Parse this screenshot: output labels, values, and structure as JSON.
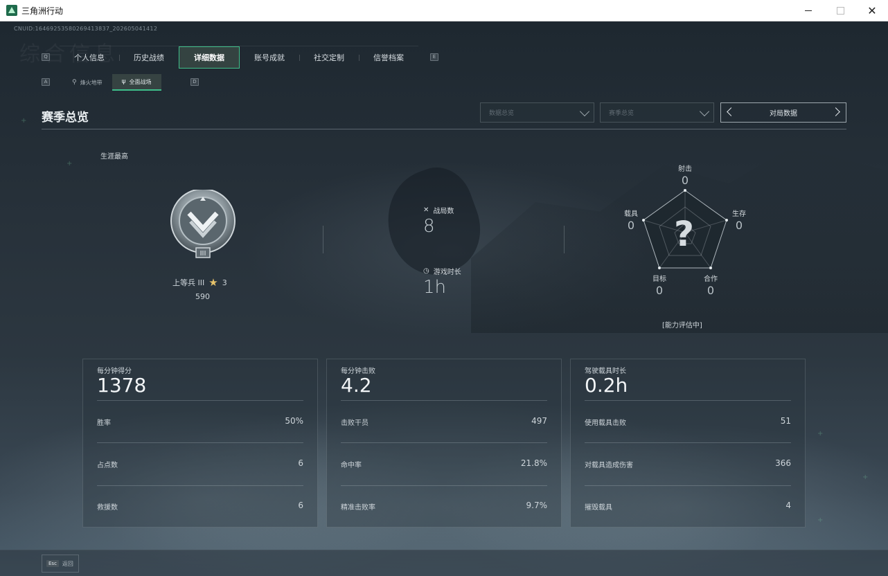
{
  "window": {
    "title": "三角洲行动"
  },
  "uid": "CNUID:16469253580269413837_202605041412",
  "watermark": "综合信息",
  "main_tabs": {
    "hint_left": "Q",
    "hint_right": "E",
    "items": [
      {
        "label": "个人信息",
        "active": false
      },
      {
        "label": "历史战绩",
        "active": false
      },
      {
        "label": "详细数据",
        "active": true
      },
      {
        "label": "账号成就",
        "active": false
      },
      {
        "label": "社交定制",
        "active": false
      },
      {
        "label": "信誉档案",
        "active": false
      }
    ]
  },
  "sub_tabs": {
    "hint_left": "A",
    "hint_right": "D",
    "items": [
      {
        "label": "烽火地带",
        "active": false
      },
      {
        "label": "全面战场",
        "active": true
      }
    ]
  },
  "section": {
    "title": "赛季总览"
  },
  "filters": {
    "dropdown1": "数据总览",
    "dropdown2": "赛季总览",
    "switcher": "对局数据"
  },
  "career": {
    "label": "生涯最高",
    "rank_name": "上等兵 III",
    "rank_stars": "3",
    "rank_points": "590"
  },
  "summary": {
    "matches_label": "战局数",
    "matches_value": "8",
    "playtime_label": "游戏时长",
    "playtime_value": "1h"
  },
  "radar": {
    "shooting_label": "射击",
    "shooting_value": "0",
    "survival_label": "生存",
    "survival_value": "0",
    "cooperation_label": "合作",
    "cooperation_value": "0",
    "objective_label": "目标",
    "objective_value": "0",
    "vehicle_label": "载具",
    "vehicle_value": "0",
    "unknown_symbol": "?",
    "note": "[能力评估中]"
  },
  "cards": [
    {
      "title": "每分钟得分",
      "big": "1378",
      "rows": [
        {
          "label": "胜率",
          "value": "50%"
        },
        {
          "label": "占点数",
          "value": "6"
        },
        {
          "label": "救援数",
          "value": "6"
        }
      ]
    },
    {
      "title": "每分钟击败",
      "big": "4.2",
      "rows": [
        {
          "label": "击败干员",
          "value": "497"
        },
        {
          "label": "命中率",
          "value": "21.8%"
        },
        {
          "label": "精准击败率",
          "value": "9.7%"
        }
      ]
    },
    {
      "title": "驾驶载具时长",
      "big": "0.2h",
      "rows": [
        {
          "label": "使用载具击败",
          "value": "51"
        },
        {
          "label": "对载具造成伤害",
          "value": "366"
        },
        {
          "label": "摧毁载具",
          "value": "4"
        }
      ]
    }
  ],
  "footer": {
    "esc_key": "Esc",
    "back_label": "返回"
  }
}
